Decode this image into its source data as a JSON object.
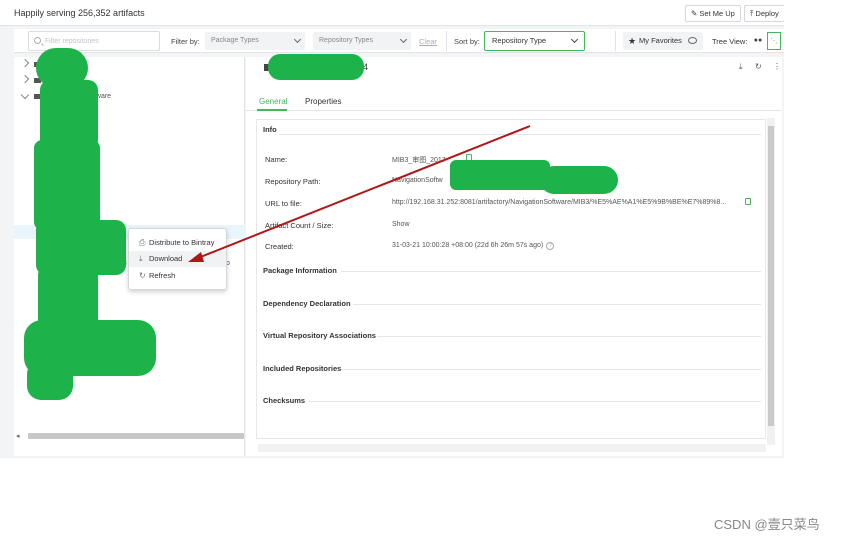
{
  "header": {
    "serving_text": "Happily serving 256,352 artifacts",
    "set_me_up": "Set Me Up",
    "deploy": "Deploy"
  },
  "filter": {
    "search_placeholder": "Filter repositories",
    "filter_by": "Filter by:",
    "package_types": "Package Types",
    "repository_types": "Repository Types",
    "clear": "Clear",
    "sort_by": "Sort by:",
    "sort_value": "Repository Type",
    "my_favorites": "My Favorites",
    "tree_view": "Tree View:"
  },
  "tree": {
    "rows": [
      "",
      "",
      "ftware"
    ],
    "row_fragment_1": "03",
    "row_fragment_2": "p"
  },
  "context_menu": {
    "items": [
      {
        "label": "Distribute to Bintray",
        "icon": "distribute-icon"
      },
      {
        "label": "Download",
        "icon": "download-icon"
      },
      {
        "label": "Refresh",
        "icon": "refresh-icon"
      }
    ]
  },
  "details": {
    "title_fragment": "4",
    "tabs": [
      "General",
      "Properties"
    ],
    "info_title": "Info",
    "fields": [
      {
        "key": "Name:",
        "value": "MIB3_审图_2017"
      },
      {
        "key": "Repository Path:",
        "value": "NavigationSoftw"
      },
      {
        "key": "URL to file:",
        "value": "http://192.168.31.252:8081/artifactory/NavigationSoftware/MIB3/%E5%AE%A1%E5%9B%BE%E7%89%8..."
      },
      {
        "key": "Artifact Count / Size:",
        "value": "Show"
      },
      {
        "key": "Created:",
        "value": "31-03-21 10:00:28 +08:00 (22d 6h 26m 57s ago)"
      }
    ],
    "sections": [
      "Package Information",
      "Dependency Declaration",
      "Virtual Repository Associations",
      "Included Repositories",
      "Checksums"
    ]
  },
  "watermark": "CSDN @壹只菜鸟",
  "colors": {
    "accent_green": "#43b85c",
    "redaction_green": "#1db34a",
    "arrow_red": "#b01818"
  }
}
